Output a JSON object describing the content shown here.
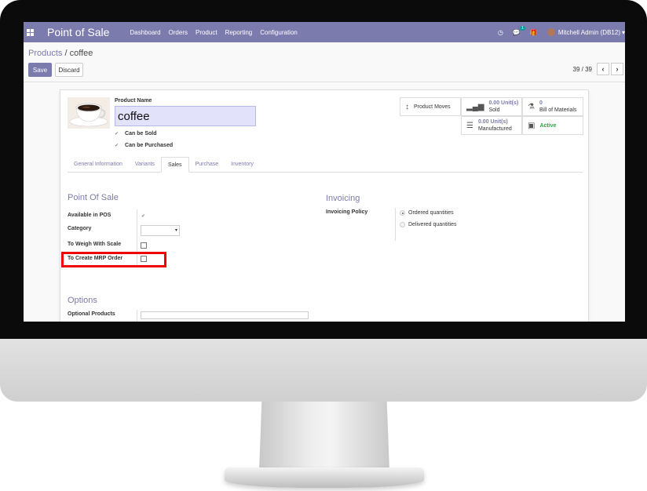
{
  "navbar": {
    "app_title": "Point of Sale",
    "menu": [
      "Dashboard",
      "Orders",
      "Product",
      "Reporting",
      "Configuration"
    ],
    "clock_icon": "clock-icon",
    "chat_icon": "chat-icon",
    "chat_count": "1",
    "gift_icon": "gift-icon",
    "user_name": "Mitchell Admin (DB12)",
    "color": "#7c7bad"
  },
  "breadcrumb": {
    "parent": "Products",
    "separator": " / ",
    "current": "coffee"
  },
  "toolbar": {
    "save_label": "Save",
    "discard_label": "Discard",
    "pager_value": "39 / 39",
    "prev_icon": "chevron-left-icon",
    "next_icon": "chevron-right-icon"
  },
  "product": {
    "name_label": "Product Name",
    "name_value": "coffee",
    "can_be_sold": "Can be Sold",
    "can_be_purchased": "Can be Purchased"
  },
  "smart_buttons": {
    "moves_label": "Product Moves",
    "sold_value": "0.00 Unit(s)",
    "sold_label": "Sold",
    "bom_value": "0",
    "bom_label": "Bill of Materials",
    "manufactured_value": "0.00 Unit(s)",
    "manufactured_label": "Manufactured",
    "active_label": "Active"
  },
  "tabs": [
    "General Information",
    "Variants",
    "Sales",
    "Purchase",
    "Inventory"
  ],
  "pos_section": {
    "title": "Point Of Sale",
    "available_in_pos": "Available in POS",
    "category": "Category",
    "to_weigh": "To Weigh With Scale",
    "to_create_mrp": "To Create MRP Order"
  },
  "invoicing": {
    "title": "Invoicing",
    "policy_label": "Invoicing Policy",
    "ordered": "Ordered quantities",
    "delivered": "Delivered quantities"
  },
  "options": {
    "title": "Options",
    "optional_products": "Optional Products"
  }
}
